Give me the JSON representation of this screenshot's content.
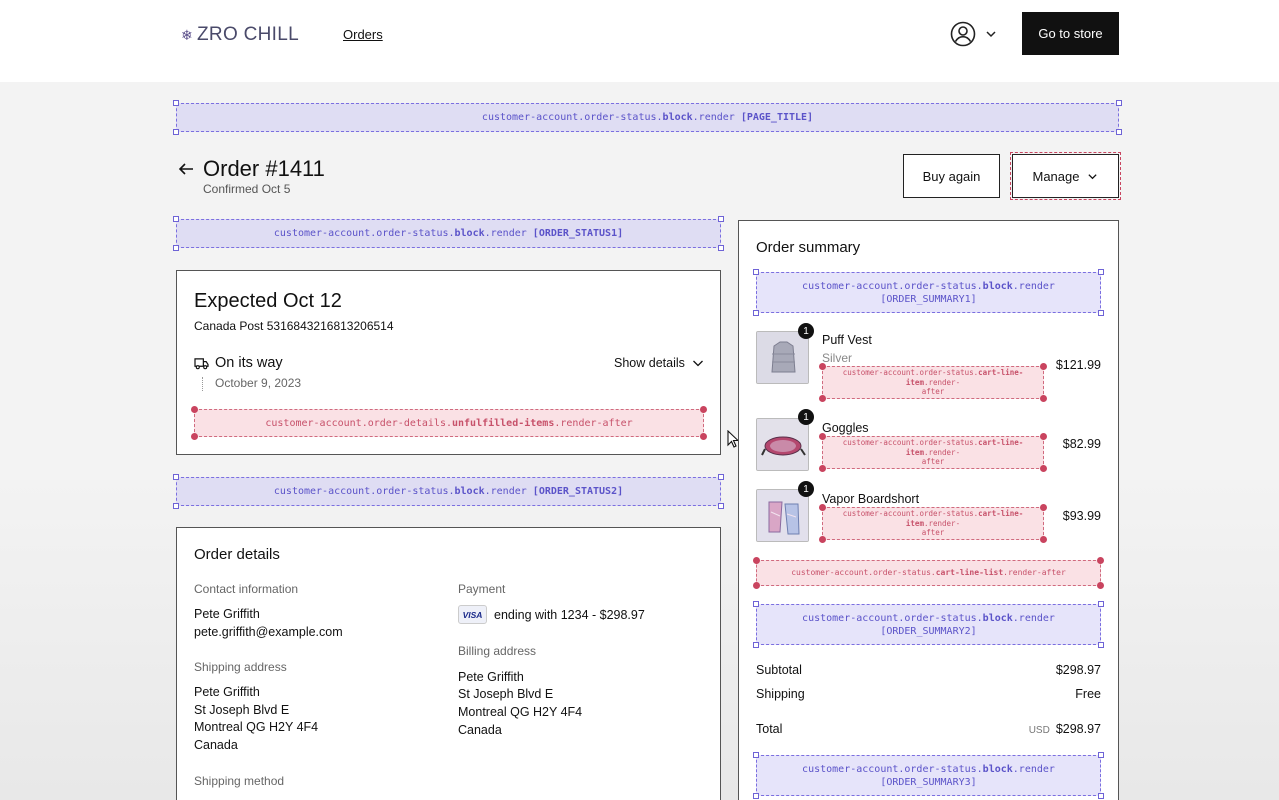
{
  "header": {
    "brand": "ZRO CHILL",
    "nav_orders": "Orders",
    "go_to_store": "Go to store"
  },
  "extensions": {
    "page_title": {
      "prefix": "customer-account.order-status.",
      "bold": "block",
      "suffix": ".render ",
      "target": "[PAGE_TITLE]"
    },
    "order_status1": {
      "prefix": "customer-account.order-status.",
      "bold": "block",
      "suffix": ".render ",
      "target": "[ORDER_STATUS1]"
    },
    "order_status2": {
      "prefix": "customer-account.order-status.",
      "bold": "block",
      "suffix": ".render ",
      "target": "[ORDER_STATUS2]"
    },
    "unfulfilled": {
      "prefix": "customer-account.order-details.",
      "bold": "unfulfilled-items",
      "suffix": ".render-after"
    },
    "order_summary1": {
      "line1": "customer-account.order-status.",
      "bold": "block",
      "line1_suffix": ".render",
      "line2": "[ORDER_SUMMARY1]"
    },
    "order_summary2": {
      "line1": "customer-account.order-status.",
      "bold": "block",
      "line1_suffix": ".render",
      "line2": "[ORDER_SUMMARY2]"
    },
    "order_summary3": {
      "line1": "customer-account.order-status.",
      "bold": "block",
      "line1_suffix": ".render",
      "line2": "[ORDER_SUMMARY3]"
    },
    "cart_line_item": {
      "line1": "customer-account.order-status.",
      "bold": "cart-line-item",
      "line1_suffix": ".render-",
      "line2": "after"
    },
    "cart_line_list": {
      "prefix": "customer-account.order-status.",
      "bold": "cart-line-list",
      "suffix": ".render-after"
    }
  },
  "order": {
    "title": "Order #1411",
    "confirmed": "Confirmed Oct 5",
    "buy_again": "Buy again",
    "manage": "Manage"
  },
  "shipment": {
    "expected": "Expected Oct 12",
    "carrier_tracking": "Canada Post 5316843216813206514",
    "status": "On its way",
    "status_date": "October 9, 2023",
    "show_details": "Show details"
  },
  "order_details": {
    "title": "Order details",
    "contact_label": "Contact information",
    "contact_name": "Pete Griffith",
    "contact_email": "pete.griffith@example.com",
    "payment_label": "Payment",
    "card_brand": "VISA",
    "payment_text": "ending with 1234 - $298.97",
    "shipping_label": "Shipping address",
    "shipping_lines": [
      "Pete Griffith",
      "St Joseph Blvd E",
      "Montreal QG H2Y 4F4",
      "Canada"
    ],
    "billing_label": "Billing address",
    "billing_lines": [
      "Pete Griffith",
      "St Joseph Blvd E",
      "Montreal QG H2Y 4F4",
      "Canada"
    ],
    "shipping_method_label": "Shipping method"
  },
  "summary": {
    "title": "Order summary",
    "items": [
      {
        "name": "Puff Vest",
        "variant": "Silver",
        "price": "$121.99",
        "qty": "1"
      },
      {
        "name": "Goggles",
        "variant": "",
        "price": "$82.99",
        "qty": "1"
      },
      {
        "name": "Vapor Boardshort",
        "variant": "",
        "price": "$93.99",
        "qty": "1"
      }
    ],
    "subtotal_label": "Subtotal",
    "subtotal": "$298.97",
    "shipping_label": "Shipping",
    "shipping": "Free",
    "total_label": "Total",
    "currency": "USD",
    "total": "$298.97"
  }
}
